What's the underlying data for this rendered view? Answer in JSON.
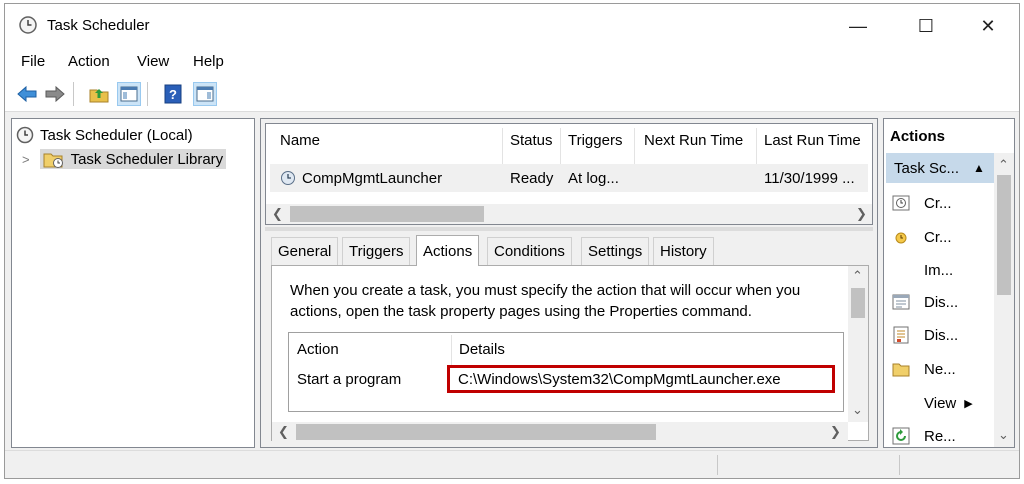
{
  "window": {
    "title": "Task Scheduler"
  },
  "window_controls": {
    "minimize": "—",
    "maximize": "☐",
    "close": "✕"
  },
  "menu": {
    "items": [
      {
        "label": "File",
        "mnemonic": "F"
      },
      {
        "label": "Action",
        "mnemonic": "A"
      },
      {
        "label": "View",
        "mnemonic": "V"
      },
      {
        "label": "Help",
        "mnemonic": "H"
      }
    ]
  },
  "toolbar": {
    "buttons": [
      "back-arrow-icon",
      "forward-arrow-icon",
      "up-folder-icon",
      "show-hide-console-tree-icon",
      "help-icon",
      "show-hide-action-pane-icon"
    ]
  },
  "tree": {
    "root_label": "Task Scheduler (Local)",
    "library_label": "Task Scheduler Library",
    "expander": ">"
  },
  "tasklist": {
    "columns": [
      "Name",
      "Status",
      "Triggers",
      "Next Run Time",
      "Last Run Time"
    ],
    "rows": [
      {
        "name": "CompMgmtLauncher",
        "status": "Ready",
        "triggers": "At log...",
        "next_run": "",
        "last_run": "11/30/1999 ..."
      }
    ]
  },
  "tabs": [
    "General",
    "Triggers",
    "Actions",
    "Conditions",
    "Settings",
    "History"
  ],
  "active_tab": "Actions",
  "actions_tab": {
    "description": "When you create a task, you must specify the action that will occur when you actions, open the task property pages using the Properties command.",
    "grid_columns": [
      "Action",
      "Details"
    ],
    "grid_rows": [
      {
        "action": "Start a program",
        "details": "C:\\Windows\\System32\\CompMgmtLauncher.exe"
      }
    ]
  },
  "actions_pane": {
    "title": "Actions",
    "group_label": "Task Sc...",
    "items": [
      {
        "label": "Cr...",
        "icon": "create-basic-task-icon"
      },
      {
        "label": "Cr...",
        "icon": "create-task-icon"
      },
      {
        "label": "Im...",
        "icon": ""
      },
      {
        "label": "Dis...",
        "icon": "display-running-tasks-icon"
      },
      {
        "label": "Dis...",
        "icon": "disable-history-icon"
      },
      {
        "label": "Ne...",
        "icon": "new-folder-icon"
      },
      {
        "label": "View",
        "icon": ""
      },
      {
        "label": "Re...",
        "icon": "refresh-icon"
      }
    ]
  },
  "colors": {
    "highlight_border": "#c00000",
    "selection": "#c6d9ea"
  }
}
